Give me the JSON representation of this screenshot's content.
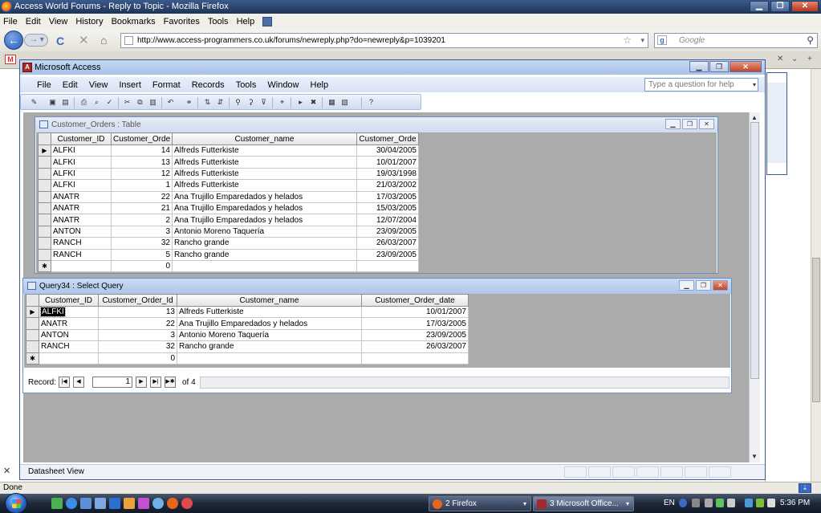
{
  "firefox": {
    "title": "Access World Forums - Reply to Topic - Mozilla Firefox",
    "menu": [
      "File",
      "Edit",
      "View",
      "History",
      "Bookmarks",
      "Favorites",
      "Tools",
      "Help"
    ],
    "url": "http://www.access-programmers.co.uk/forums/newreply.php?do=newreply&p=1039201",
    "search_placeholder": "Google",
    "status": "Done"
  },
  "access": {
    "title": "Microsoft Access",
    "menu": [
      "File",
      "Edit",
      "View",
      "Insert",
      "Format",
      "Records",
      "Tools",
      "Window",
      "Help"
    ],
    "help_placeholder": "Type a question for help",
    "status": "Datasheet View"
  },
  "table_window": {
    "title": "Customer_Orders : Table",
    "columns": [
      "Customer_ID",
      "Customer_Orde",
      "Customer_name",
      "Customer_Orde"
    ],
    "rows": [
      [
        "ALFKI",
        "14",
        "Alfreds Futterkiste",
        "30/04/2005"
      ],
      [
        "ALFKI",
        "13",
        "Alfreds Futterkiste",
        "10/01/2007"
      ],
      [
        "ALFKI",
        "12",
        "Alfreds Futterkiste",
        "19/03/1998"
      ],
      [
        "ALFKI",
        "1",
        "Alfreds Futterkiste",
        "21/03/2002"
      ],
      [
        "ANATR",
        "22",
        "Ana Trujillo Emparedados y helados",
        "17/03/2005"
      ],
      [
        "ANATR",
        "21",
        "Ana Trujillo Emparedados y helados",
        "15/03/2005"
      ],
      [
        "ANATR",
        "2",
        "Ana Trujillo Emparedados y helados",
        "12/07/2004"
      ],
      [
        "ANTON",
        "3",
        "Antonio Moreno Taquería",
        "23/09/2005"
      ],
      [
        "RANCH",
        "32",
        "Rancho grande",
        "26/03/2007"
      ],
      [
        "RANCH",
        "5",
        "Rancho grande",
        "23/09/2005"
      ]
    ],
    "new_row": [
      "",
      "0",
      "",
      ""
    ]
  },
  "query_window": {
    "title": "Query34 : Select Query",
    "columns": [
      "Customer_ID",
      "Customer_Order_Id",
      "Customer_name",
      "Customer_Order_date"
    ],
    "rows": [
      [
        "ALFKI",
        "13",
        "Alfreds Futterkiste",
        "10/01/2007"
      ],
      [
        "ANATR",
        "22",
        "Ana Trujillo Emparedados y helados",
        "17/03/2005"
      ],
      [
        "ANTON",
        "3",
        "Antonio Moreno Taquería",
        "23/09/2005"
      ],
      [
        "RANCH",
        "32",
        "Rancho grande",
        "26/03/2007"
      ]
    ],
    "new_row": [
      "",
      "0",
      "",
      ""
    ],
    "record_label": "Record:",
    "record_current": "1",
    "record_of": "of 4"
  },
  "taskbar": {
    "tasks": [
      "2 Firefox",
      "3 Microsoft Office..."
    ],
    "language": "EN",
    "clock": "5:36 PM"
  },
  "colors": {
    "access_title": "#a9c2e6",
    "mdi_background": "#ababab",
    "taskbar": "#1e2838"
  }
}
